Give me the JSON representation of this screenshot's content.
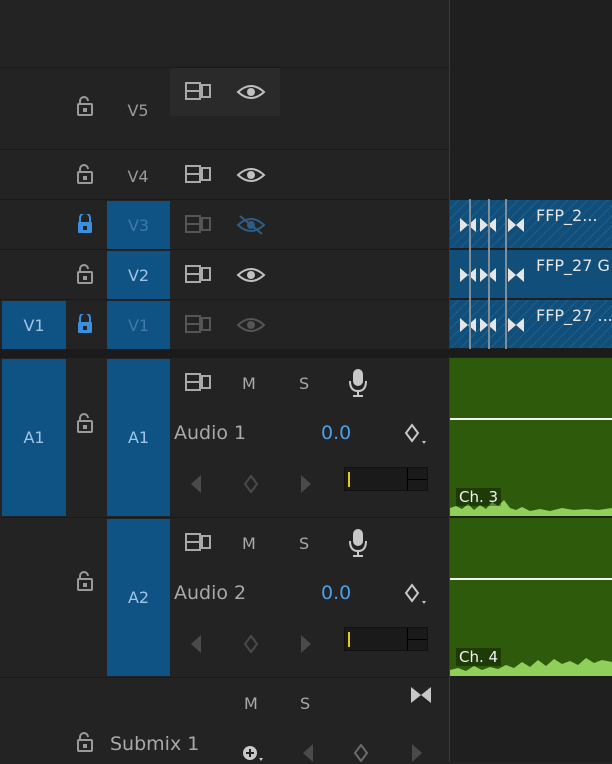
{
  "video_tracks": [
    {
      "id": "v5",
      "label": "V5",
      "locked": false,
      "source_patch": "",
      "dim": false,
      "visible": true
    },
    {
      "id": "v4",
      "label": "V4",
      "locked": false,
      "source_patch": "",
      "dim": false,
      "visible": true
    },
    {
      "id": "v3",
      "label": "V3",
      "locked": true,
      "source_patch": "",
      "dim": true,
      "visible": false
    },
    {
      "id": "v2",
      "label": "V2",
      "locked": false,
      "source_patch": "",
      "dim": false,
      "visible": true
    },
    {
      "id": "v1",
      "label": "V1",
      "locked": true,
      "source_patch": "V1",
      "dim": true,
      "visible": true
    }
  ],
  "audio_tracks": [
    {
      "id": "a1",
      "source_patch": "A1",
      "label": "A1",
      "name": "Audio 1",
      "volume": "0.0",
      "mute": "M",
      "solo": "S",
      "channel": "Ch. 3"
    },
    {
      "id": "a2",
      "source_patch": "",
      "label": "A2",
      "name": "Audio 2",
      "volume": "0.0",
      "mute": "M",
      "solo": "S",
      "channel": "Ch. 4"
    }
  ],
  "submix": {
    "name": "Submix 1",
    "mute": "M",
    "solo": "S"
  },
  "clips": {
    "v3": "FFP_2...",
    "v2": "FFP_27 G",
    "v1": "FFP_27 ..."
  },
  "colors": {
    "accent": "#0f5384",
    "volume": "#4a9fe6",
    "audio_clip": "#2e5a0b",
    "lock_active": "#3b8fe0"
  },
  "icons": [
    "lock-icon",
    "sync-lock-icon",
    "eye-icon",
    "eye-hidden-icon",
    "microphone-icon",
    "keyframe-icon",
    "prev-keyframe-icon",
    "next-keyframe-icon",
    "transition-icon",
    "add-effect-icon"
  ]
}
